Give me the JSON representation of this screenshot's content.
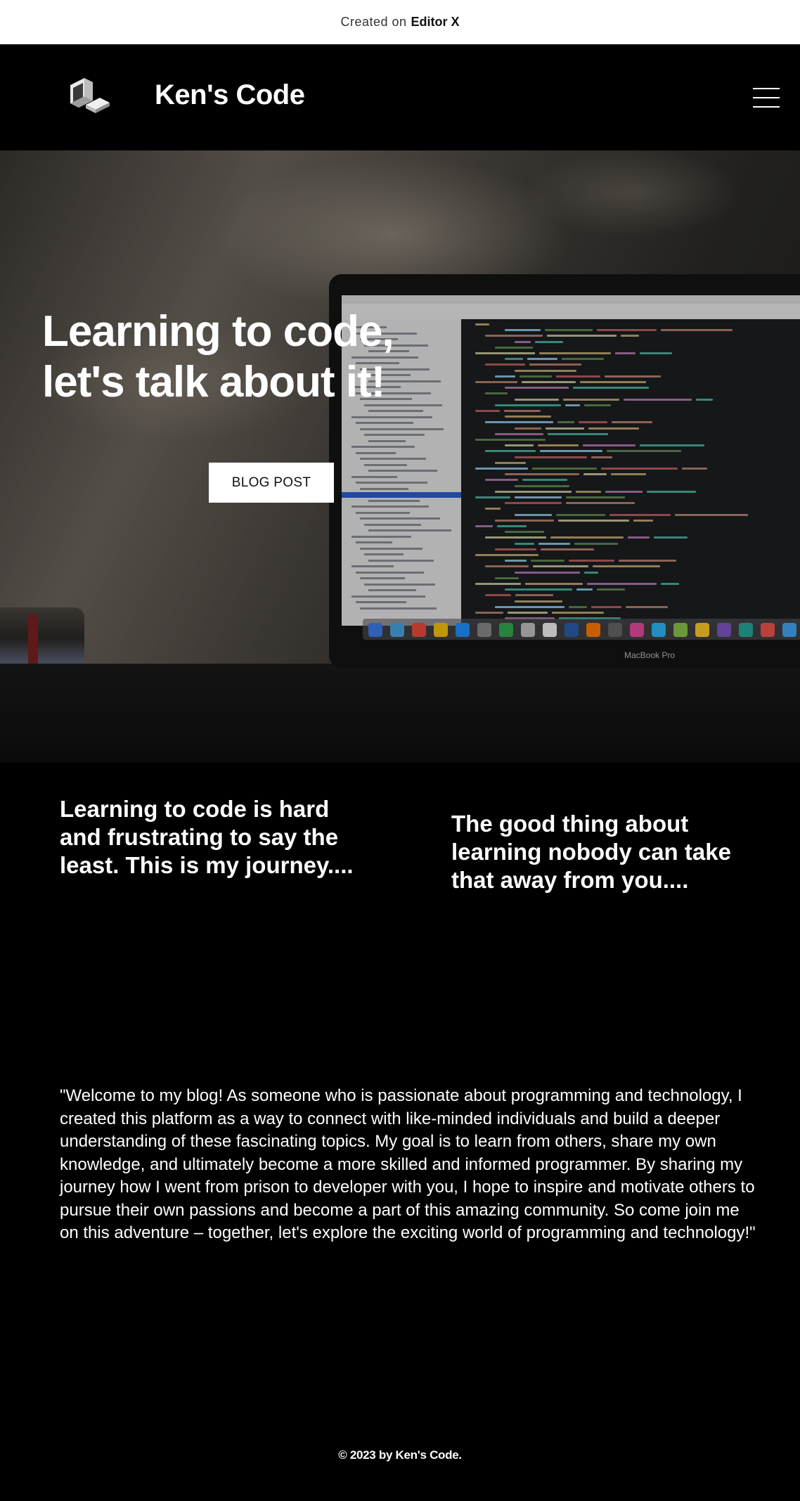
{
  "banner": {
    "prefix": "Created on",
    "brand": "Editor X"
  },
  "header": {
    "logo_icon": "retro-computer-icon",
    "title": "Ken's Code",
    "menu_icon": "hamburger-menu-icon"
  },
  "hero": {
    "title": "Learning to code, let's talk about it!",
    "button_label": "BLOG POST",
    "laptop_label": "MacBook Pro"
  },
  "intro": {
    "left": "Learning to code is hard and frustrating to say the least. This is my journey....",
    "right": "The good thing about learning nobody can take that away from you...."
  },
  "welcome": {
    "text": "\"Welcome to my blog! As someone who is passionate about programming and technology, I created this platform as a way to connect with like-minded individuals and build a deeper understanding of these fascinating topics. My goal is to learn from others, share my own knowledge, and ultimately become a more skilled and informed programmer. By sharing my journey how I went from prison to developer with you, I hope to inspire and motivate others to pursue their own passions and become a part of this amazing community. So come join me on this adventure – together, let's explore the exciting world of programming and technology!\""
  },
  "footer": {
    "copyright": "© 2023 by Ken's Code."
  },
  "colors": {
    "background": "#000000",
    "banner": "#ffffff",
    "text": "#ffffff",
    "button_bg": "#ffffff",
    "button_text": "#111111"
  }
}
